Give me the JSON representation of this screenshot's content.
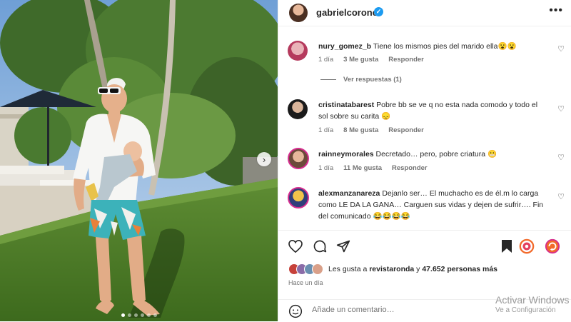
{
  "header": {
    "username": "gabrielcoronel",
    "verified_icon": "verified-badge-icon",
    "more_icon": "more-options-icon"
  },
  "comments": [
    {
      "username": "nury_gomez_b",
      "text": "Tiene los mismos pies del marido ella😮😮",
      "time": "1 día",
      "likes": "3 Me gusta",
      "reply": "Responder",
      "view_replies": "Ver respuestas (1)"
    },
    {
      "username": "cristinatabarest",
      "text": "Pobre bb se ve q no esta nada comodo y todo el sol sobre su carita 😞",
      "time": "1 día",
      "likes": "8 Me gusta",
      "reply": "Responder"
    },
    {
      "username": "rainneymorales",
      "text": "Decretado… pero, pobre criatura 😬",
      "time": "1 día",
      "likes": "11 Me gusta",
      "reply": "Responder"
    },
    {
      "username": "alexmanzanareza",
      "text": "Dejanlo ser… El muchacho es de él.m lo carga como LE DA LA GANA… Carguen sus vidas y dejen de sufrir…. Fin del comunicado 😂😂😂😂"
    }
  ],
  "actions": {
    "like_icon": "heart-icon",
    "comment_icon": "comment-icon",
    "share_icon": "share-icon",
    "save_icon": "bookmark-icon"
  },
  "likes": {
    "prefix": "Les gusta a",
    "user": "revistaronda",
    "middle": "y",
    "count": "47.652 personas más"
  },
  "time_ago": "Hace un día",
  "add_comment": {
    "placeholder": "Añade un comentario…",
    "emoji_icon": "emoji-icon"
  },
  "watermark": {
    "line1": "Activar Windows",
    "line2": "Ve a Configuración"
  },
  "carousel": {
    "total": 6,
    "current": 1
  },
  "colors": {
    "verified": "#1d9bf0",
    "text": "#262626",
    "muted": "#737373",
    "grass": "#4f7a2a"
  }
}
